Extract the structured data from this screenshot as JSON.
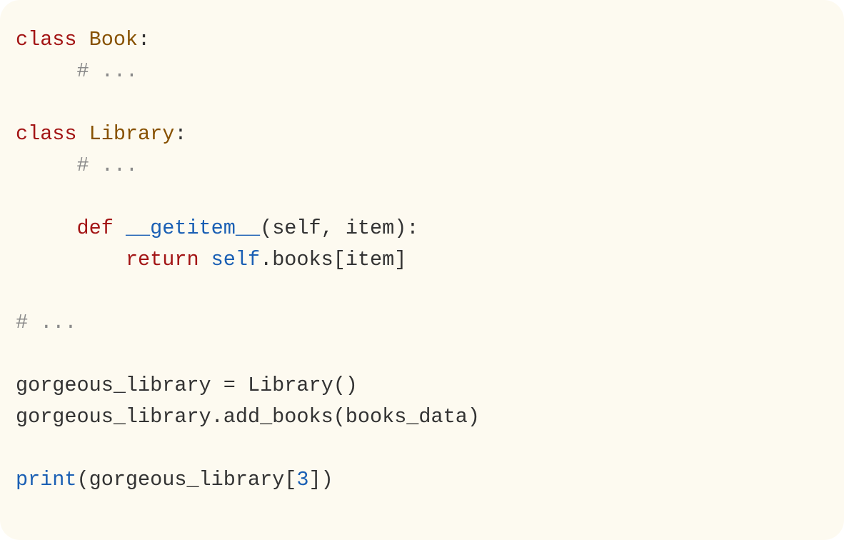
{
  "code": {
    "kw_class1": "class",
    "name_book": "Book",
    "colon": ":",
    "comment_ellipsis": "# ...",
    "kw_class2": "class",
    "name_library": "Library",
    "kw_def": "def",
    "fn_getitem": "__getitem__",
    "sig_open": "(",
    "sig_self": "self",
    "sig_comma": ", ",
    "sig_item": "item",
    "sig_close": ")",
    "kw_return": "return",
    "ret_self": "self",
    "ret_dot": ".",
    "ret_books": "books",
    "ret_lbrack": "[",
    "ret_item": "item",
    "ret_rbrack": "]",
    "var_gl": "gorgeous_library",
    "eq": " = ",
    "call_library": "Library",
    "call_paren": "()",
    "call_addbooks": ".add_books(",
    "arg_booksdata": "books_data",
    "call_close": ")",
    "fn_print": "print",
    "print_open": "(",
    "print_lbrack": "[",
    "num_3": "3",
    "print_rbrack": "]",
    "print_close": ")"
  }
}
